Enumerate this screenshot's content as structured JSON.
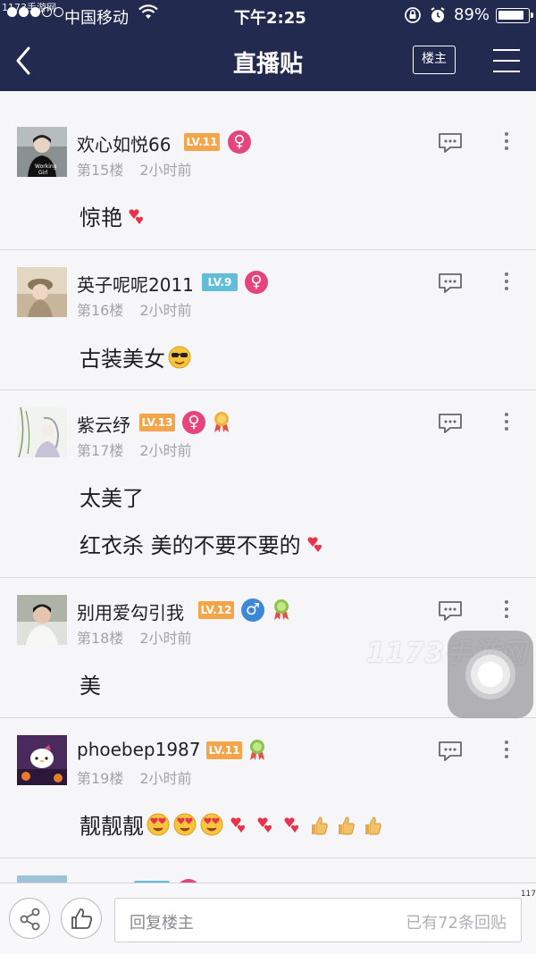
{
  "statusbar": {
    "watermark": "1173手游网",
    "carrier": "中国移动",
    "time": "下午2:25",
    "battery": "89%"
  },
  "navbar": {
    "back_icon": "chevron-left-icon",
    "title": "直播贴",
    "louzhu_label": "楼主",
    "menu_icon": "hamburger-menu-icon"
  },
  "posts": [
    {
      "username": "欢心如悦66",
      "level": "LV.11",
      "gender": "♀",
      "floor": "第15楼",
      "time": "2小时前",
      "content": [
        "惊艳"
      ]
    },
    {
      "username": "英子呢呢2011",
      "level": "LV.9",
      "gender": "♀",
      "floor": "第16楼",
      "time": "2小时前",
      "content": [
        "古装美女"
      ]
    },
    {
      "username": "紫云纾",
      "level": "LV.13",
      "gender": "♀",
      "floor": "第17楼",
      "time": "2小时前",
      "content": [
        "太美了",
        "红衣杀 美的不要不要的"
      ]
    },
    {
      "username": "别用爱勾引我",
      "level": "LV.12",
      "gender": "♂",
      "floor": "第18楼",
      "time": "2小时前",
      "content": [
        "美"
      ]
    },
    {
      "username": "phoebep1987",
      "level": "LV.11",
      "floor": "第19楼",
      "time": "2小时前",
      "content": [
        "靓靓靓"
      ]
    }
  ],
  "watermark_overlay": "1173手游网",
  "bottombar": {
    "share_icon": "share-icon",
    "like_icon": "thumbs-up-icon",
    "reply_placeholder": "回复楼主",
    "reply_count": "已有72条回贴"
  },
  "edge_number": "117",
  "colors": {
    "nav_bg": "#232a50",
    "level_orange": "#f3a649",
    "level_blue": "#62bdd9",
    "female": "#e5457a",
    "male": "#3e87d7"
  }
}
